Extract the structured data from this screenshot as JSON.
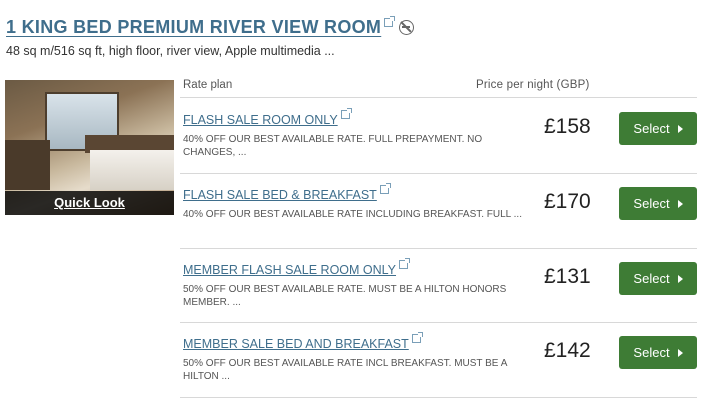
{
  "room": {
    "title": "1 KING BED PREMIUM RIVER VIEW ROOM",
    "description": "48 sq m/516 sq ft, high floor, river view, Apple multimedia ...",
    "quick_look_label": "Quick Look",
    "icons": [
      "external-link-icon",
      "no-smoking-icon"
    ]
  },
  "table": {
    "rate_plan_header": "Rate plan",
    "price_header": "Price per night (GBP)"
  },
  "rates": [
    {
      "name": "FLASH SALE ROOM ONLY",
      "description": "40% OFF OUR BEST AVAILABLE RATE. FULL PREPAYMENT. NO CHANGES, ...",
      "price": "£158",
      "button": "Select"
    },
    {
      "name": "FLASH SALE BED & BREAKFAST",
      "description": "40% OFF OUR BEST AVAILABLE RATE INCLUDING BREAKFAST. FULL ...",
      "price": "£170",
      "button": "Select"
    },
    {
      "name": "MEMBER FLASH SALE ROOM ONLY",
      "description": "50% OFF OUR BEST AVAILABLE RATE. MUST BE A HILTON HONORS MEMBER. ...",
      "price": "£131",
      "button": "Select"
    },
    {
      "name": "MEMBER SALE BED AND BREAKFAST",
      "description": "50% OFF OUR BEST AVAILABLE RATE INCL BREAKFAST. MUST BE A HILTON ...",
      "price": "£142",
      "button": "Select"
    }
  ],
  "colors": {
    "link": "#3f6e8c",
    "button": "#3e7c35"
  }
}
